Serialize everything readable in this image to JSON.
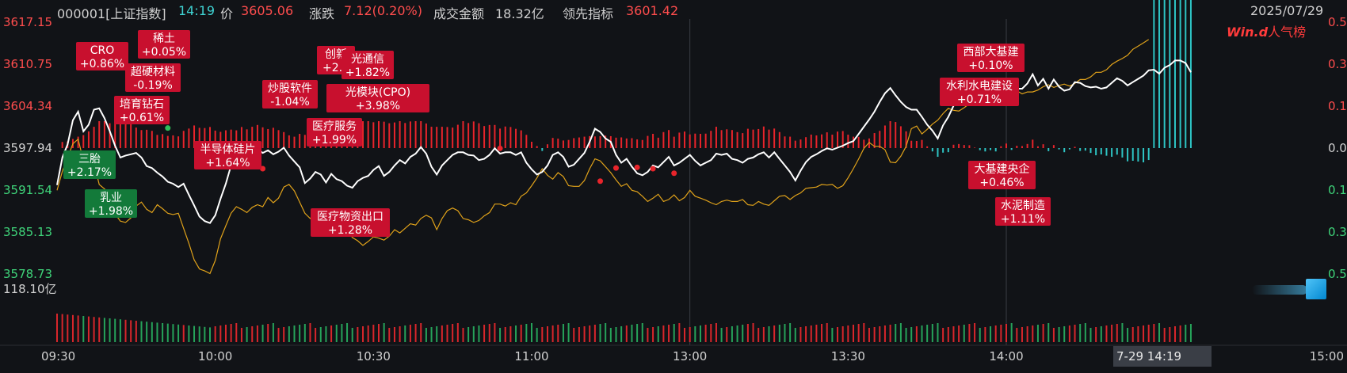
{
  "header": {
    "code": "000001[上证指数]",
    "time": "14:19",
    "price_label": "价",
    "price": "3605.06",
    "change_label": "涨跌",
    "change": "7.12(0.20%)",
    "turnover_label": "成交金额",
    "turnover": "18.32亿",
    "lead_label": "领先指标",
    "lead": "3601.42",
    "date": "2025/07/29"
  },
  "brand": {
    "logo": "Win.d",
    "text": "人气榜"
  },
  "cursor_label": "7-29 14:19",
  "colors": {
    "price_line": "#ffffff",
    "lead_line": "#e0a21a",
    "up": "#e8242b",
    "down": "#2ec4c4",
    "up_tag": "#c8102e",
    "down_tag": "#137a3a",
    "vol_up": "#d9262b",
    "vol_down": "#26a35a"
  },
  "chart_data": {
    "type": "line",
    "y_ticks_left": [
      "3617.15",
      "3610.75",
      "3604.34",
      "3597.94",
      "3591.54",
      "3585.13",
      "3578.73"
    ],
    "y_ticks_right": [
      "0.5",
      "0.3",
      "0.1",
      "0.0",
      "0.1",
      "0.3",
      "0.5"
    ],
    "ylim": [
      3578.73,
      3617.15
    ],
    "volume_label": "118.10亿",
    "x_ticks": [
      "09:30",
      "10:00",
      "10:30",
      "11:00",
      "13:00",
      "13:30",
      "14:00",
      "15:00"
    ],
    "series": [
      {
        "key": "price",
        "values": [
          3592.3,
          3596.5,
          3598.5,
          3602.2,
          3603.5,
          3600.5,
          3601.5,
          3603.8,
          3604.0,
          3602.5,
          3600.5,
          3598.3,
          3596.5,
          3596.8,
          3597.0,
          3597.2,
          3596.5,
          3595.2,
          3594.9,
          3594.2,
          3593.6,
          3592.8,
          3592.5,
          3592.0,
          3592.5,
          3590.8,
          3589.2,
          3587.5,
          3586.8,
          3586.5,
          3587.7,
          3590.2,
          3592.5,
          3595.3,
          3595.7,
          3596.3,
          3595.5,
          3597.0,
          3597.8,
          3597.2,
          3597.6,
          3597.0,
          3597.4,
          3598.0,
          3596.8,
          3595.9,
          3595.0,
          3592.6,
          3593.3,
          3594.3,
          3593.9,
          3592.7,
          3594.0,
          3593.2,
          3592.9,
          3592.2,
          3591.9,
          3592.9,
          3593.4,
          3593.7,
          3594.6,
          3595.2,
          3593.7,
          3594.3,
          3595.3,
          3596.1,
          3595.6,
          3596.6,
          3597.1,
          3598.1,
          3597.1,
          3595.1,
          3593.9,
          3595.3,
          3596.1,
          3596.9,
          3597.3,
          3597.3,
          3596.9,
          3596.8,
          3596.1,
          3596.3,
          3596.9,
          3597.9,
          3597.1,
          3597.3,
          3597.3,
          3596.9,
          3597.3,
          3595.7,
          3594.7,
          3593.9,
          3594.3,
          3595.3,
          3596.9,
          3597.3,
          3596.6,
          3595.1,
          3595.4,
          3596.3,
          3597.2,
          3598.9,
          3600.9,
          3600.4,
          3599.4,
          3598.9,
          3596.9,
          3595.7,
          3596.3,
          3595.1,
          3594.1,
          3593.8,
          3594.3,
          3595.3,
          3595.0,
          3595.8,
          3596.6,
          3595.3,
          3595.7,
          3596.3,
          3596.9,
          3596.0,
          3595.3,
          3595.7,
          3596.1,
          3597.1,
          3596.9,
          3597.1,
          3596.3,
          3596.1,
          3595.7,
          3596.3,
          3596.5,
          3597.0,
          3597.3,
          3596.5,
          3597.3,
          3596.3,
          3595.3,
          3594.3,
          3593.0,
          3594.5,
          3595.8,
          3596.6,
          3597.0,
          3597.5,
          3597.9,
          3597.7,
          3598.0,
          3598.3,
          3598.7,
          3599.0,
          3600.1,
          3601.2,
          3602.3,
          3603.5,
          3605.0,
          3606.3,
          3607.1,
          3606.0,
          3605.0,
          3604.2,
          3603.8,
          3603.8,
          3602.7,
          3601.5,
          3600.6,
          3599.4,
          3601.4,
          3602.7,
          3604.4,
          3605.2,
          3605.0,
          3605.2,
          3605.2,
          3605.0,
          3605.1,
          3604.8,
          3605.2,
          3606.3,
          3607.7,
          3606.3,
          3607.0,
          3607.0,
          3607.8,
          3609.2,
          3607.5,
          3608.5,
          3607.0,
          3608.4,
          3607.3,
          3606.7,
          3606.9,
          3608.0,
          3607.9,
          3607.4,
          3607.2,
          3607.3,
          3607.0,
          3607.2,
          3607.9,
          3608.6,
          3608.2,
          3607.5,
          3608.0,
          3608.5,
          3609.0,
          3609.8,
          3609.9,
          3609.3,
          3610.2,
          3610.6,
          3611.3,
          3611.3,
          3610.9,
          3609.5
        ]
      },
      {
        "key": "lead",
        "values": [
          3591.5,
          3594.4,
          3596.5,
          3598.6,
          3599.3,
          3596.0,
          3594.9,
          3595.7,
          3592.4,
          3591.7,
          3591.0,
          3587.9,
          3586.8,
          3586.6,
          3587.3,
          3589.1,
          3589.7,
          3588.6,
          3588.1,
          3589.3,
          3588.7,
          3588.0,
          3587.8,
          3588.0,
          3585.7,
          3583.4,
          3580.9,
          3579.5,
          3579.2,
          3578.8,
          3580.8,
          3584.1,
          3586.1,
          3588.0,
          3589.0,
          3588.6,
          3588.1,
          3588.9,
          3589.3,
          3589.0,
          3590.4,
          3589.6,
          3590.3,
          3592.0,
          3592.4,
          3591.4,
          3589.7,
          3588.0,
          3587.2,
          3588.1,
          3588.1,
          3587.2,
          3586.9,
          3588.0,
          3586.3,
          3585.5,
          3584.3,
          3583.8,
          3583.1,
          3583.7,
          3584.4,
          3584.2,
          3583.9,
          3584.5,
          3585.5,
          3585.0,
          3585.7,
          3586.4,
          3586.2,
          3587.2,
          3587.7,
          3587.3,
          3585.5,
          3587.2,
          3588.4,
          3588.8,
          3588.4,
          3587.2,
          3587.0,
          3586.6,
          3586.9,
          3587.6,
          3588.1,
          3589.4,
          3589.4,
          3589.1,
          3589.6,
          3589.3,
          3590.6,
          3591.1,
          3592.2,
          3593.4,
          3594.8,
          3593.8,
          3593.2,
          3594.2,
          3593.6,
          3592.2,
          3592.1,
          3592.1,
          3593.0,
          3594.8,
          3596.3,
          3596.0,
          3595.1,
          3594.2,
          3593.1,
          3592.1,
          3592.5,
          3591.5,
          3591.3,
          3590.6,
          3589.8,
          3590.3,
          3590.9,
          3589.8,
          3590.1,
          3590.8,
          3589.9,
          3590.4,
          3591.5,
          3590.6,
          3590.3,
          3590.0,
          3589.6,
          3589.3,
          3589.8,
          3590.0,
          3589.8,
          3589.8,
          3590.1,
          3589.3,
          3589.2,
          3589.8,
          3589.4,
          3589.2,
          3589.9,
          3590.6,
          3590.7,
          3590.1,
          3590.7,
          3591.1,
          3591.8,
          3591.9,
          3592.0,
          3592.4,
          3592.3,
          3592.4,
          3591.8,
          3592.2,
          3593.4,
          3594.8,
          3596.3,
          3597.9,
          3598.8,
          3598.2,
          3598.2,
          3597.7,
          3595.8,
          3595.7,
          3596.7,
          3598.2,
          3600.9,
          3601.3,
          3600.1,
          3600.8,
          3601.6,
          3602.2,
          3603.2,
          3604.0,
          3603.7,
          3603.6,
          3604.1,
          3604.7,
          3605.0,
          3605.5,
          3605.8,
          3605.6,
          3606.2,
          3606.2,
          3605.9,
          3606.7,
          3606.7,
          3606.2,
          3606.5,
          3606.5,
          3606.8,
          3607.3,
          3607.6,
          3607.2,
          3607.5,
          3607.7,
          3607.4,
          3607.8,
          3608.4,
          3608.4,
          3608.8,
          3609.5,
          3609.5,
          3609.9,
          3610.7,
          3611.2,
          3611.6,
          3612.1,
          3613.0,
          3613.5,
          3614.0,
          3614.5
        ]
      }
    ]
  },
  "markers": [
    {
      "t": 14,
      "v": 3603.9,
      "c": "green"
    },
    {
      "t": 17,
      "v": 3604.0,
      "c": "red"
    },
    {
      "t": 21,
      "v": 3601.0,
      "c": "green"
    },
    {
      "t": 31,
      "v": 3596.6,
      "c": "red"
    },
    {
      "t": 35,
      "v": 3595.3,
      "c": "red"
    },
    {
      "t": 39,
      "v": 3594.8,
      "c": "red"
    },
    {
      "t": 56,
      "v": 3587.7,
      "c": "red"
    },
    {
      "t": 84,
      "v": 3597.9,
      "c": "red"
    },
    {
      "t": 103,
      "v": 3592.9,
      "c": "red"
    },
    {
      "t": 106,
      "v": 3594.9,
      "c": "red"
    },
    {
      "t": 110,
      "v": 3595.0,
      "c": "red"
    },
    {
      "t": 113,
      "v": 3594.8,
      "c": "red"
    },
    {
      "t": 117,
      "v": 3594.1,
      "c": "red"
    },
    {
      "t": 351,
      "v": 3598.7,
      "c": "red"
    },
    {
      "t": 355,
      "v": 3598.9,
      "c": "red"
    },
    {
      "t": 359,
      "v": 3601.4,
      "c": "red"
    },
    {
      "t": 364,
      "v": 3604.2,
      "c": "red"
    }
  ],
  "annotations": [
    {
      "label": "CRO",
      "pct": "+0.86%",
      "c": "red",
      "t": 17
    },
    {
      "label": "稀土",
      "pct": "+0.05%",
      "c": "red",
      "t": 27
    },
    {
      "label": "超硬材料",
      "pct": "-0.19%",
      "c": "red",
      "t": 29
    },
    {
      "label": "培育钻石",
      "pct": "+0.61%",
      "c": "red",
      "t": 25
    },
    {
      "label": "三胎",
      "pct": "+2.17%",
      "c": "green",
      "t": 14
    },
    {
      "label": "乳业",
      "pct": "+1.98%",
      "c": "green",
      "t": 21
    },
    {
      "label": "半导体硅片",
      "pct": "+1.64%",
      "c": "red",
      "t": 56
    },
    {
      "label": "炒股软件",
      "pct": "-1.04%",
      "c": "red",
      "t": 84
    },
    {
      "label": "医疗服务",
      "pct": "+1.99%",
      "c": "red",
      "t": 103
    },
    {
      "label": "创新",
      "pct": "+2.0",
      "c": "red",
      "t": 106
    },
    {
      "label": "光通信",
      "pct": "+1.82%",
      "c": "red",
      "t": 110
    },
    {
      "label": "光模块(CPO)",
      "pct": "+3.98%",
      "c": "red",
      "t": 113
    },
    {
      "label": "医疗物资出口",
      "pct": "+1.28%",
      "c": "red",
      "t": 117
    },
    {
      "label": "西部大基建",
      "pct": "+0.10%",
      "c": "red",
      "t": 355
    },
    {
      "label": "水利水电建设",
      "pct": "+0.71%",
      "c": "red",
      "t": 359
    },
    {
      "label": "大基建央企",
      "pct": "+0.46%",
      "c": "red",
      "t": 351
    },
    {
      "label": "水泥制造",
      "pct": "+1.11%",
      "c": "red",
      "t": 364
    }
  ]
}
